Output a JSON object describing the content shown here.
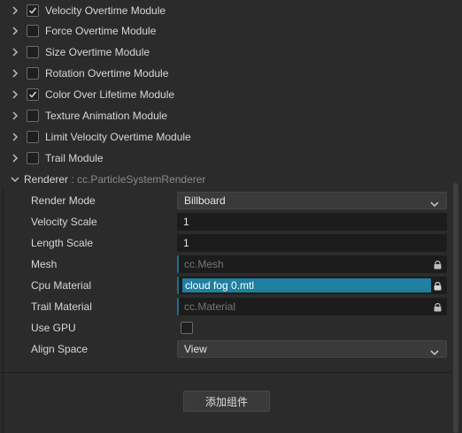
{
  "modules": [
    {
      "label": "Velocity Overtime Module",
      "checked": true
    },
    {
      "label": "Force Overtime Module",
      "checked": false
    },
    {
      "label": "Size Overtime Module",
      "checked": false
    },
    {
      "label": "Rotation Overtime Module",
      "checked": false
    },
    {
      "label": "Color Over Lifetime Module",
      "checked": true
    },
    {
      "label": "Texture Animation Module",
      "checked": false
    },
    {
      "label": "Limit Velocity Overtime Module",
      "checked": false
    },
    {
      "label": "Trail Module",
      "checked": false
    }
  ],
  "renderer": {
    "title": "Renderer",
    "subtitle": ": cc.ParticleSystemRenderer",
    "render_mode": {
      "label": "Render Mode",
      "value": "Billboard"
    },
    "velocity_scale": {
      "label": "Velocity Scale",
      "value": "1"
    },
    "length_scale": {
      "label": "Length Scale",
      "value": "1"
    },
    "mesh": {
      "label": "Mesh",
      "placeholder": "cc.Mesh"
    },
    "cpu_material": {
      "label": "Cpu Material",
      "value": "cloud fog 0.mtl"
    },
    "trail_material": {
      "label": "Trail Material",
      "placeholder": "cc.Material"
    },
    "use_gpu": {
      "label": "Use GPU",
      "checked": false
    },
    "align_space": {
      "label": "Align Space",
      "value": "View"
    }
  },
  "add_component_label": "添加组件",
  "colors": {
    "accent": "#1f7fa0",
    "check": "#d6d6d6"
  }
}
